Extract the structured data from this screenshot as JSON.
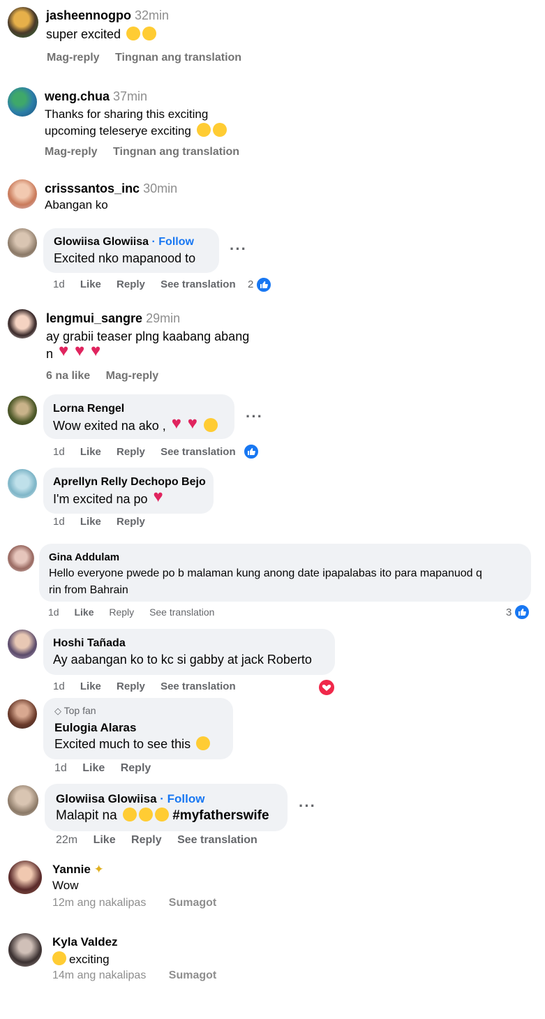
{
  "comments": [
    {
      "name": "jasheennogpo",
      "time": "32min",
      "text": "super excited",
      "actions": [
        "Mag-reply",
        "Tingnan ang translation"
      ]
    },
    {
      "name": "weng.chua",
      "time": "37min",
      "text_lines": [
        "Thanks for sharing this exciting",
        "upcoming teleserye exciting"
      ],
      "actions": [
        "Mag-reply",
        "Tingnan ang translation"
      ]
    },
    {
      "name": "crisssantos_inc",
      "time": "30min",
      "text": "Abangan ko"
    },
    {
      "name": "Glowiisa Glowiisa",
      "follow": "· Follow",
      "text": "Excited nko mapanood to",
      "time": "1d",
      "actions": [
        "Like",
        "Reply",
        "See translation"
      ],
      "reactions": "2"
    },
    {
      "name": "lengmui_sangre",
      "time": "29min",
      "text_lines": [
        "ay grabii teaser plng kaabang abang",
        "n"
      ],
      "likes": "6 na like",
      "actions": [
        "Mag-reply"
      ]
    },
    {
      "name": "Lorna Rengel",
      "text": "Wow exited na ako ,",
      "time": "1d",
      "actions": [
        "Like",
        "Reply",
        "See translation"
      ]
    },
    {
      "name": "Aprellyn Relly Dechopo Bejo",
      "text": "I'm excited na po",
      "time": "1d",
      "actions": [
        "Like",
        "Reply"
      ]
    },
    {
      "name": "Gina Addulam",
      "text_lines": [
        "Hello everyone pwede po b malaman kung anong date ipapalabas ito para mapanuod q",
        "rin from Bahrain"
      ],
      "time": "1d",
      "actions": [
        "Like",
        "Reply",
        "See translation"
      ],
      "reactions": "3"
    },
    {
      "name": "Hoshi Tañada",
      "text": "Ay aabangan ko to kc si gabby at jack Roberto",
      "time": "1d",
      "actions": [
        "Like",
        "Reply",
        "See translation"
      ]
    },
    {
      "badge": "Top fan",
      "name": "Eulogia Alaras",
      "text": "Excited much to see this",
      "time": "1d",
      "actions": [
        "Like",
        "Reply"
      ]
    },
    {
      "name": "Glowiisa Glowiisa",
      "follow": "· Follow",
      "text": "Malapit na",
      "hashtag": "#myfatherswife",
      "time": "22m",
      "actions": [
        "Like",
        "Reply",
        "See translation"
      ]
    },
    {
      "name": "Yannie",
      "text": "Wow",
      "time": "12m ang nakalipas",
      "actions": [
        "Sumagot"
      ]
    },
    {
      "name": "Kyla Valdez",
      "text": "exciting",
      "time": "14m ang nakalipas",
      "actions": [
        "Sumagot"
      ]
    }
  ],
  "more_label": "···",
  "colors": {
    "link": "#1877f2",
    "bubble": "#f0f2f5",
    "meta": "#65676b",
    "heart": "#e0245e"
  }
}
